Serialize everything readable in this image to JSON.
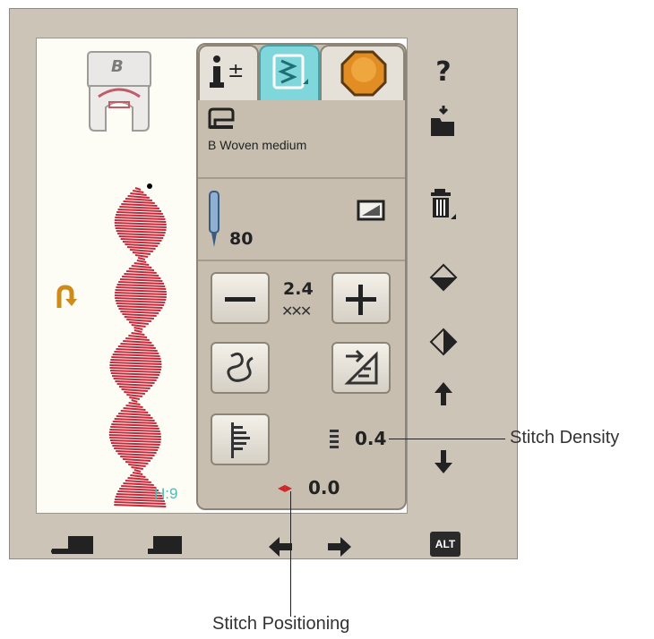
{
  "foot": {
    "letter": "B"
  },
  "stitch_preview": {
    "height_label": "H:9"
  },
  "tabs": [
    {
      "name": "info-settings-tab"
    },
    {
      "name": "stitch-tab"
    },
    {
      "name": "embroidery-tab"
    }
  ],
  "fabric": {
    "label": "B Woven medium"
  },
  "needle": {
    "size": "80"
  },
  "stitch": {
    "width": "2.4",
    "density": "0.4",
    "positioning": "0.0"
  },
  "sidebar": {
    "help": "?",
    "alt": "ALT"
  },
  "callouts": {
    "density": "Stitch Density",
    "positioning": "Stitch Positioning"
  },
  "colors": {
    "accent": "#7fd7dc",
    "stitch": "#c8283a",
    "panel": "#c7beb0",
    "frame": "#cdc4b8"
  }
}
